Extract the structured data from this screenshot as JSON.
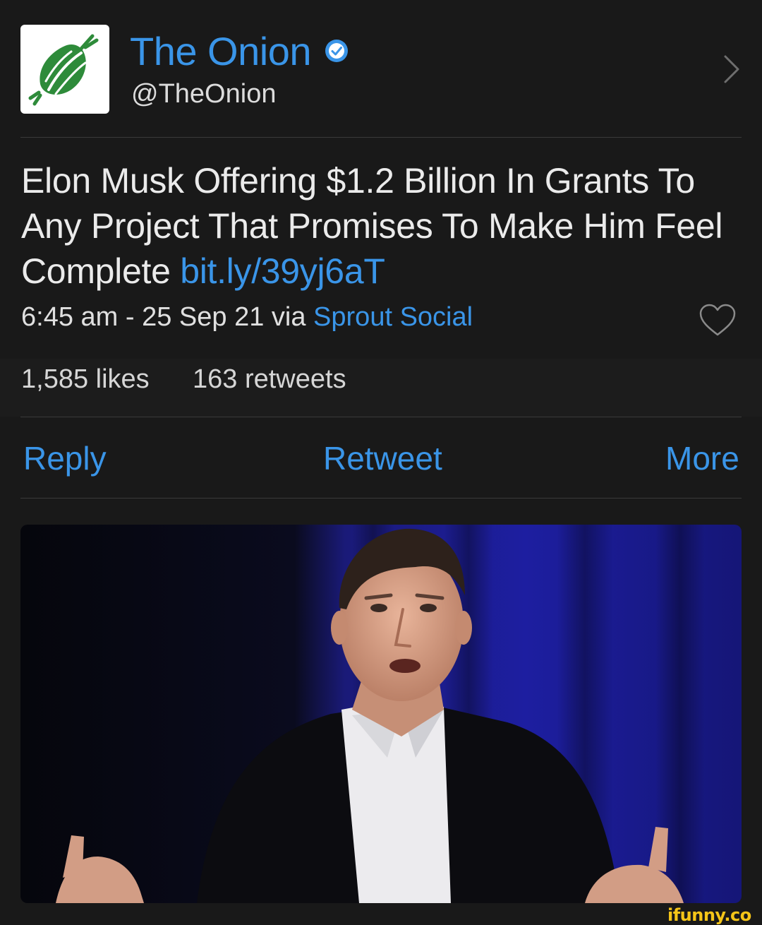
{
  "profile": {
    "display_name": "The Onion",
    "handle": "@TheOnion",
    "avatar_icon": "onion-logo-icon",
    "verified_icon": "verified-badge-icon"
  },
  "tweet": {
    "text": "Elon Musk Offering $1.2 Billion In Grants To Any Project That Promises To Make Him Feel Complete",
    "link": "bit.ly/39yj6aT",
    "timestamp": "6:45 am - 25 Sep 21",
    "via_label": "via",
    "source": "Sprout Social"
  },
  "stats": {
    "likes": "1,585 likes",
    "retweets": "163 retweets"
  },
  "actions": {
    "reply": "Reply",
    "retweet": "Retweet",
    "more": "More"
  },
  "watermark": "ifunny.co",
  "colors": {
    "background": "#191919",
    "link_blue": "#3a95e8",
    "onion_green": "#2e8b3a",
    "watermark_yellow": "#f5c518"
  }
}
